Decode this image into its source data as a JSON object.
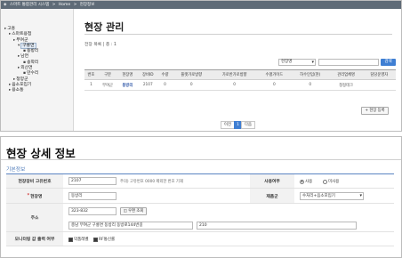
{
  "breadcrumb": [
    "◈",
    "스마트 통합관리 시스템",
    ">",
    "Home",
    ">",
    "현장정보"
  ],
  "sidebar": {
    "items": [
      {
        "glyph": "▸",
        "label": "고흥",
        "indent": 0
      },
      {
        "glyph": "▸",
        "label": "스마트용접",
        "indent": 1
      },
      {
        "glyph": "▸",
        "label": "부여군",
        "indent": 2
      },
      {
        "glyph": "▾",
        "label": "구룡면",
        "indent": 3,
        "selected": true
      },
      {
        "glyph": "▪",
        "label": "동방리",
        "indent": 4
      },
      {
        "glyph": "▸",
        "label": "남면",
        "indent": 3
      },
      {
        "glyph": "▪",
        "label": "송학리",
        "indent": 4
      },
      {
        "glyph": "▸",
        "label": "외산면",
        "indent": 3
      },
      {
        "glyph": "▪",
        "label": "만수리",
        "indent": 4
      },
      {
        "glyph": "▸",
        "label": "청양군",
        "indent": 2
      },
      {
        "glyph": "▸",
        "label": "음소포입기",
        "indent": 1
      },
      {
        "glyph": "▸",
        "label": "용소통",
        "indent": 1
      }
    ]
  },
  "content": {
    "title": "현장 관리",
    "total": "전장 목록 | 총 : 1",
    "search": {
      "select": "현장명",
      "button": "검색"
    },
    "table": {
      "headers": [
        "번호",
        "구분",
        "현장명",
        "장비ID",
        "수량",
        "플랫가로방향",
        "가로반가로방향",
        "수평가이드",
        "하수인입(현)",
        "관리업체명",
        "담당운영자"
      ],
      "rows": [
        [
          "1",
          "부여군",
          "동방리",
          "2107",
          "0",
          "0",
          "0",
          "0",
          "0",
          "청정테크",
          ""
        ]
      ]
    },
    "add_button": "+ 현장 등록",
    "pagination": {
      "prev": "이전",
      "pages": [
        "1"
      ],
      "active": "1",
      "next": "다음"
    }
  },
  "detail": {
    "title": "현장 상세 정보",
    "section": "기본정보",
    "rows": {
      "id_label": "현장장비 고유번호",
      "id_value": "2107",
      "id_note": "주의) 고유번호 0000 제외한 번호 기재",
      "use_label": "사용여부",
      "use_on": "사용",
      "use_off": "미사용",
      "name_label": "현장명",
      "name_value": "동방리",
      "vendor_label": "제품군",
      "vendor_value": "수처리+음소포입기",
      "addr_label": "주소",
      "zip_value": "323-832",
      "zip_button": "우편 조회",
      "addr1_value": "충남 부여군 구룡면 동방리 동방로144번길",
      "addr2_value": "210",
      "monitor_label": "모니터링 값 출력 여부",
      "monitor_opt1": "악품레벨",
      "monitor_opt2": "RF통신률"
    }
  }
}
